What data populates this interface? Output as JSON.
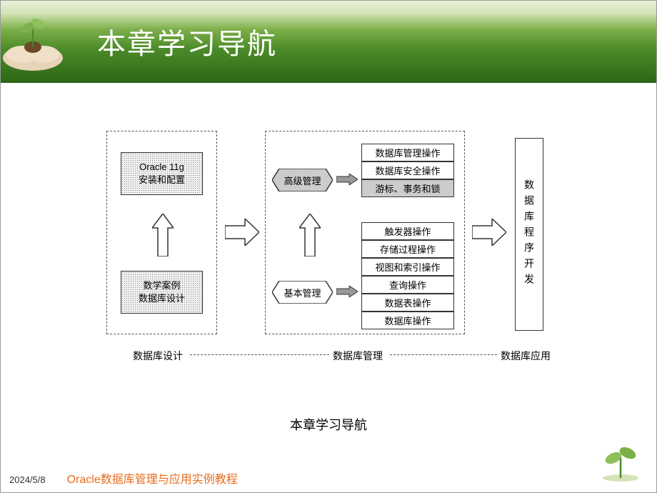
{
  "header": {
    "title": "本章学习导航"
  },
  "diagram": {
    "group1": {
      "box_install": "Oracle 11g\n安装和配置",
      "box_case": "数学案例\n数据库设计"
    },
    "group2": {
      "hex_advanced": "高级管理",
      "hex_basic": "基本管理",
      "advanced_items": [
        "数据库管理操作",
        "数据库安全操作",
        "游标、事务和锁"
      ],
      "basic_items": [
        "触发器操作",
        "存储过程操作",
        "视图和索引操作",
        "查询操作",
        "数据表操作",
        "数据库操作"
      ]
    },
    "tall_box": "数据库程序开发",
    "bottom_labels": [
      "数据库设计",
      "数据库管理",
      "数据库应用"
    ]
  },
  "caption": "本章学习导航",
  "footer": {
    "date": "2024/5/8",
    "book_title": "Oracle数据库管理与应用实例教程"
  }
}
